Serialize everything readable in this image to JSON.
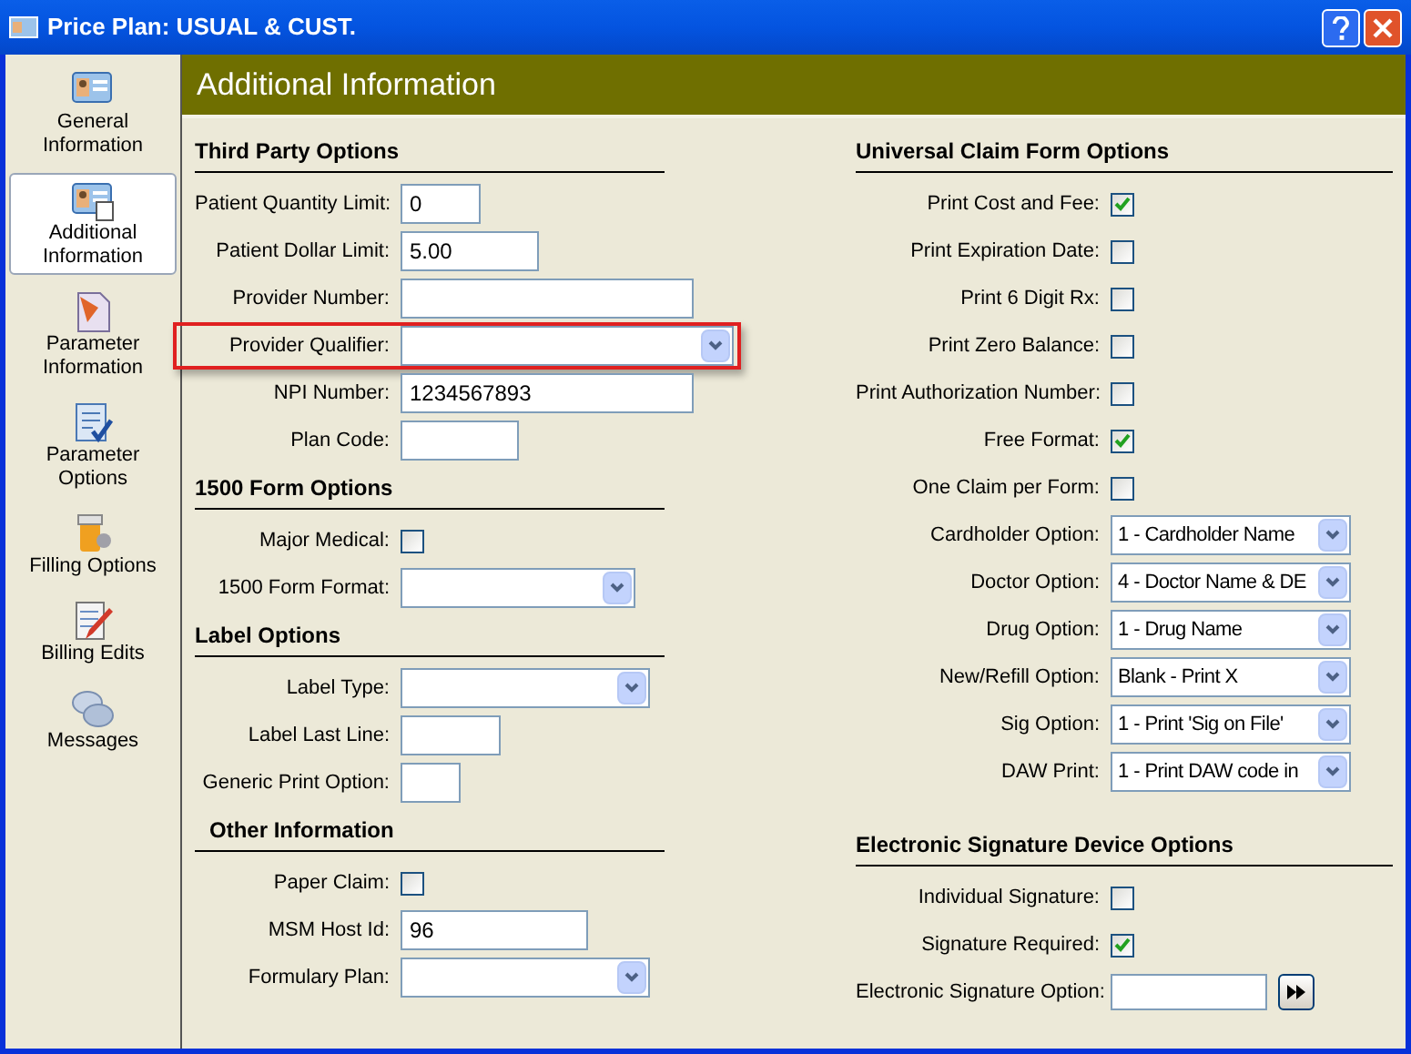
{
  "window": {
    "title": "Price Plan: USUAL & CUST."
  },
  "sidebar": {
    "items": [
      {
        "label": "General Information",
        "kind": "card",
        "selected": false
      },
      {
        "label": "Additional Information",
        "kind": "card2",
        "selected": true
      },
      {
        "label": "Parameter Information",
        "kind": "document",
        "selected": false
      },
      {
        "label": "Parameter Options",
        "kind": "checklist",
        "selected": false
      },
      {
        "label": "Filling Options",
        "kind": "pills",
        "selected": false
      },
      {
        "label": "Billing Edits",
        "kind": "notepad",
        "selected": false
      },
      {
        "label": "Messages",
        "kind": "chat",
        "selected": false
      }
    ]
  },
  "header": {
    "title": "Additional Information"
  },
  "columns": [
    {
      "sections": [
        {
          "title": "Third Party Options",
          "fields": [
            {
              "label": "Patient Quantity Limit:",
              "kind": "text",
              "value": "0",
              "highlighted": false
            },
            {
              "label": "Patient Dollar Limit:",
              "kind": "text",
              "value": "5.00",
              "highlighted": false
            },
            {
              "label": "Provider Number:",
              "kind": "text",
              "highlighted": false
            },
            {
              "label": "Provider Qualifier:",
              "kind": "select",
              "highlighted": true
            },
            {
              "label": "NPI Number:",
              "kind": "text",
              "value": "1234567893",
              "highlighted": false
            },
            {
              "label": "Plan Code:",
              "kind": "text",
              "highlighted": false
            }
          ]
        },
        {
          "title": "1500 Form Options",
          "fields": [
            {
              "label": "Major Medical:",
              "kind": "checkbox",
              "checked": false
            },
            {
              "label": "1500 Form Format:",
              "kind": "select"
            }
          ]
        },
        {
          "title": "Label Options",
          "fields": [
            {
              "label": "Label Type:",
              "kind": "select"
            },
            {
              "label": "Label Last Line:",
              "kind": "text"
            },
            {
              "label": "Generic Print Option:",
              "kind": "text"
            }
          ]
        },
        {
          "title": "Other Information",
          "fields": [
            {
              "label": "Paper Claim:",
              "kind": "checkbox",
              "checked": false
            },
            {
              "label": "MSM Host Id:",
              "kind": "text",
              "value": "96"
            },
            {
              "label": "Formulary Plan:",
              "kind": "select"
            }
          ]
        }
      ]
    },
    {
      "sections": [
        {
          "title": "Universal Claim Form Options",
          "fields": [
            {
              "label": "Print Cost and Fee:",
              "kind": "checkbox",
              "checked": true
            },
            {
              "label": "Print Expiration Date:",
              "kind": "checkbox",
              "checked": false
            },
            {
              "label": "Print 6 Digit Rx:",
              "kind": "checkbox",
              "checked": false
            },
            {
              "label": "Print Zero Balance:",
              "kind": "checkbox",
              "checked": false
            },
            {
              "label": "Print Authorization Number:",
              "kind": "checkbox",
              "checked": false
            },
            {
              "label": "Free Format:",
              "kind": "checkbox",
              "checked": true
            },
            {
              "label": "One Claim per Form:",
              "kind": "checkbox",
              "checked": false
            },
            {
              "label": "Cardholder Option:",
              "kind": "select",
              "value": "1 - Cardholder Name"
            },
            {
              "label": "Doctor Option:",
              "kind": "select",
              "value": "4 - Doctor Name & DE"
            },
            {
              "label": "Drug Option:",
              "kind": "select",
              "value": "1 - Drug Name"
            },
            {
              "label": "New/Refill Option:",
              "kind": "select",
              "value": "Blank - Print X"
            },
            {
              "label": "Sig Option:",
              "kind": "select",
              "value": "1 - Print 'Sig on File'"
            },
            {
              "label": "DAW Print:",
              "kind": "select",
              "value": "1 - Print DAW code in"
            }
          ]
        },
        {
          "title": "Electronic Signature Device Options",
          "fields": [
            {
              "label": "Individual Signature:",
              "kind": "checkbox",
              "checked": false
            },
            {
              "label": "Signature Required:",
              "kind": "checkbox",
              "checked": true
            },
            {
              "label": "Electronic Signature Option:",
              "kind": "text_button"
            }
          ]
        }
      ]
    }
  ]
}
